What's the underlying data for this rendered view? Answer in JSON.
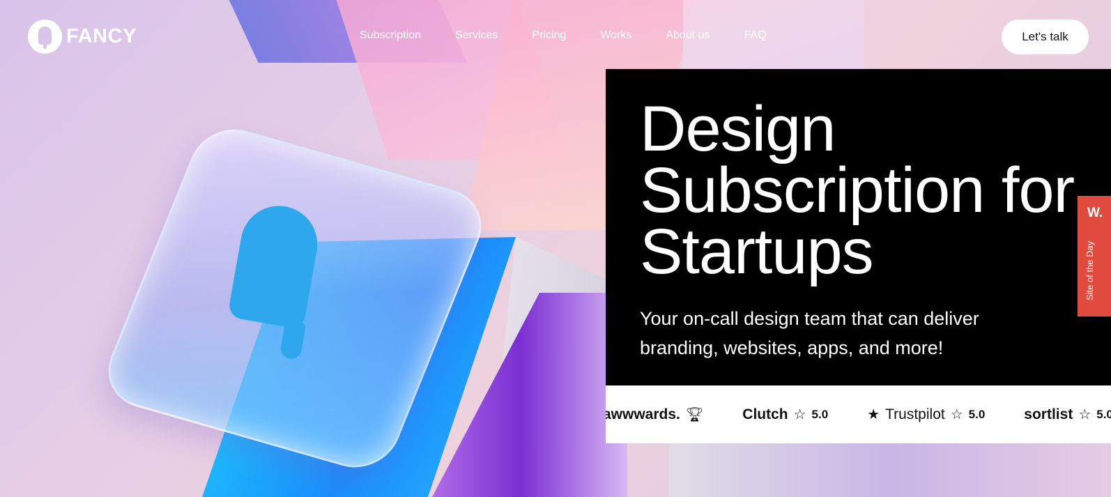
{
  "brand": {
    "name": "FANCY"
  },
  "nav": {
    "items": [
      "Subscription",
      "Services",
      "Pricing",
      "Works",
      "About us",
      "FAQ"
    ]
  },
  "cta_label": "Let's talk",
  "hero": {
    "title": "Design Subscription for Startups",
    "subtitle": "Your on-call design team that can deliver branding, websites, apps, and more!"
  },
  "ratings": {
    "awwwards": {
      "brand": "awwwards.",
      "icon": "trophy-icon"
    },
    "clutch": {
      "brand": "Clutch",
      "score": "5.0"
    },
    "trustpilot": {
      "brand": "Trustpilot",
      "score": "5.0"
    },
    "sortlist": {
      "brand": "sortlist",
      "score": "5.0"
    }
  },
  "badge": {
    "mark": "W.",
    "text": "Site of the Day"
  },
  "colors": {
    "hero_bg": "#000000",
    "badge_red": "#e04a3f",
    "background": "#e6cfe6"
  }
}
